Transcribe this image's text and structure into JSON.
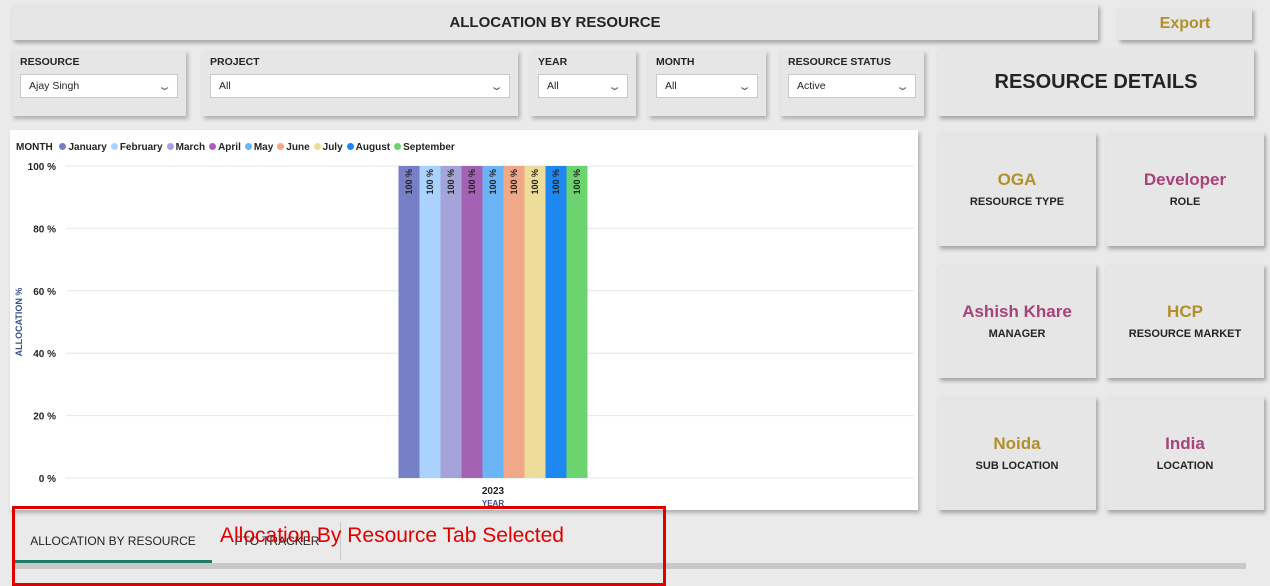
{
  "header": {
    "title": "ALLOCATION BY RESOURCE",
    "export_label": "Export"
  },
  "filters": [
    {
      "label": "RESOURCE",
      "value": "Ajay Singh"
    },
    {
      "label": "PROJECT",
      "value": "All"
    },
    {
      "label": "YEAR",
      "value": "All"
    },
    {
      "label": "MONTH",
      "value": "All"
    },
    {
      "label": "RESOURCE STATUS",
      "value": "Active"
    }
  ],
  "resource_details": {
    "title": "RESOURCE DETAILS",
    "tiles": [
      {
        "value": "OGA",
        "label": "RESOURCE TYPE",
        "color": "#b08f2c"
      },
      {
        "value": "Developer",
        "label": "ROLE",
        "color": "#a8427a"
      },
      {
        "value": "Ashish Khare",
        "label": "MANAGER",
        "color": "#a8427a"
      },
      {
        "value": "HCP",
        "label": "RESOURCE MARKET",
        "color": "#b08f2c"
      },
      {
        "value": "Noida",
        "label": "SUB LOCATION",
        "color": "#b08f2c"
      },
      {
        "value": "India",
        "label": "LOCATION",
        "color": "#a8427a"
      }
    ]
  },
  "chart_data": {
    "type": "bar",
    "legend_title": "MONTH",
    "legend_position": "top-left",
    "categories": [
      "2023"
    ],
    "xlabel": "YEAR",
    "ylabel": "ALLOCATION %",
    "ylim": [
      0,
      100
    ],
    "yticks": [
      "0 %",
      "20 %",
      "40 %",
      "60 %",
      "80 %",
      "100 %"
    ],
    "grid": true,
    "series": [
      {
        "name": "January",
        "values": [
          100
        ],
        "label": "100 %",
        "color": "#7780c6"
      },
      {
        "name": "February",
        "values": [
          100
        ],
        "label": "100 %",
        "color": "#a9d2ff"
      },
      {
        "name": "March",
        "values": [
          100
        ],
        "label": "100 %",
        "color": "#a4a4da"
      },
      {
        "name": "April",
        "values": [
          100
        ],
        "label": "100 %",
        "color": "#a462b4"
      },
      {
        "name": "May",
        "values": [
          100
        ],
        "label": "100 %",
        "color": "#6bb4f5"
      },
      {
        "name": "June",
        "values": [
          100
        ],
        "label": "100 %",
        "color": "#f0a888"
      },
      {
        "name": "July",
        "values": [
          100
        ],
        "label": "100 %",
        "color": "#eedc9a"
      },
      {
        "name": "August",
        "values": [
          100
        ],
        "label": "100 %",
        "color": "#1e88f0"
      },
      {
        "name": "September",
        "values": [
          100
        ],
        "label": "100 %",
        "color": "#6bd46e"
      }
    ]
  },
  "tabs": [
    {
      "label": "ALLOCATION BY RESOURCE",
      "active": true
    },
    {
      "label": "PTO TRACKER",
      "active": false
    }
  ],
  "annotation": {
    "text": "Allocation By Resource Tab Selected"
  }
}
